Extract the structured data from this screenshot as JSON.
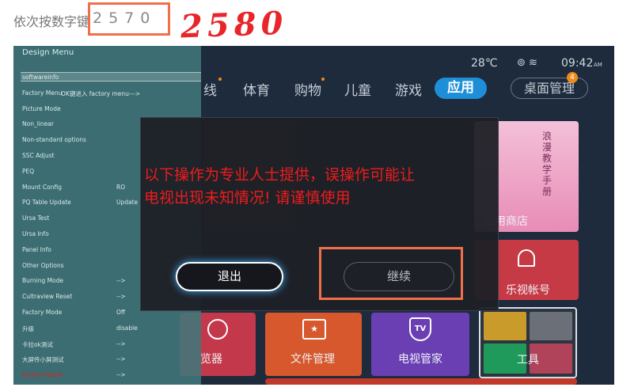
{
  "instruction": {
    "prefix": "依次按数字键",
    "code": "2570",
    "handwritten": "2580"
  },
  "status": {
    "weather": "28℃",
    "time": "09:42",
    "time_suffix": "AM"
  },
  "nav": {
    "partial_first": "线",
    "items": [
      "体育",
      "购物",
      "儿童",
      "游戏"
    ],
    "active": "应用",
    "manager": "桌面管理",
    "manager_badge": "4"
  },
  "design_menu": {
    "title": "Design Menu",
    "items": [
      {
        "label": "softwareinfo",
        "value": ""
      },
      {
        "label": "Factory Menu",
        "value": "OK键进入 factory menu--->"
      },
      {
        "label": "Picture Mode",
        "value": ""
      },
      {
        "label": "Non_linear",
        "value": ""
      },
      {
        "label": "Non-standard options",
        "value": ""
      },
      {
        "label": "SSC Adjust",
        "value": ""
      },
      {
        "label": "PEQ",
        "value": ""
      },
      {
        "label": "Mount Config",
        "value": "RO"
      },
      {
        "label": "PQ Table Update",
        "value": "Update"
      },
      {
        "label": "Ursa Test",
        "value": ""
      },
      {
        "label": "Ursa Info",
        "value": ""
      },
      {
        "label": "Panel Info",
        "value": ""
      },
      {
        "label": "Other Options",
        "value": ""
      },
      {
        "label": "Burning Mode",
        "value": "-->"
      },
      {
        "label": "Cultraview Reset",
        "value": "-->"
      },
      {
        "label": "Factory Mode",
        "value": "Off"
      },
      {
        "label": "升级",
        "value": "disable"
      },
      {
        "label": "卡拉ok测试",
        "value": "-->"
      },
      {
        "label": "大屏传小屏测试",
        "value": "-->"
      },
      {
        "label": "Factory Reset",
        "value": "-->"
      }
    ]
  },
  "dialog": {
    "line1": "以下操作为专业人士提供，误操作可能让",
    "line2": "电视出现未知情况! 请谨慎使用",
    "exit_label": "退出",
    "continue_label": "继续"
  },
  "tiles": {
    "app_store": "应用商店",
    "account": "乐视帐号",
    "browser": "览器",
    "file_manager": "文件管理",
    "tv_manager": "电视管家",
    "tools": "工具",
    "poster_text": "浪漫教学手册"
  },
  "colors": {
    "annotation": "#f0704a",
    "warning_text": "#ee1c1c",
    "active_tab": "#1d8fd8",
    "menu_bg": "#40767a"
  }
}
